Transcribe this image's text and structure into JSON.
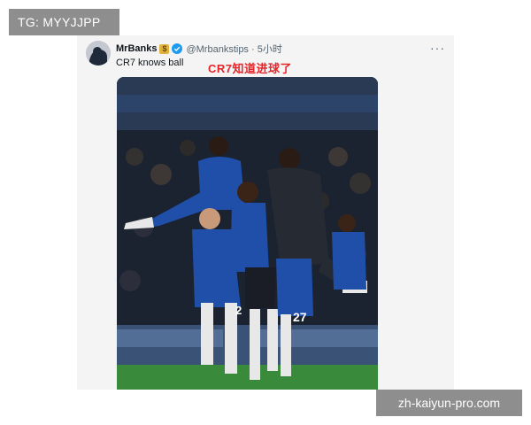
{
  "watermark_top": "TG: MYYJJPP",
  "watermark_bottom": "zh-kaiyun-pro.com",
  "tweet": {
    "username": "MrBanks",
    "name_emoji": "money-bag-emoji",
    "verified_icon": "verified-badge-icon",
    "handle_time": "@Mrbankstips · 5小时",
    "text": "CR7 knows ball",
    "image_caption": "CR7知道进球了",
    "more_icon": "more-options-icon",
    "more_label": "···",
    "media": {
      "description_icon": "football-celebration-photo",
      "jersey_numbers": [
        "2",
        "27"
      ],
      "colors": {
        "kit": "#1f4fa8",
        "pitch": "#3a8a3c",
        "caption": "#e5252a",
        "verified": "#1d9bf0"
      }
    }
  }
}
